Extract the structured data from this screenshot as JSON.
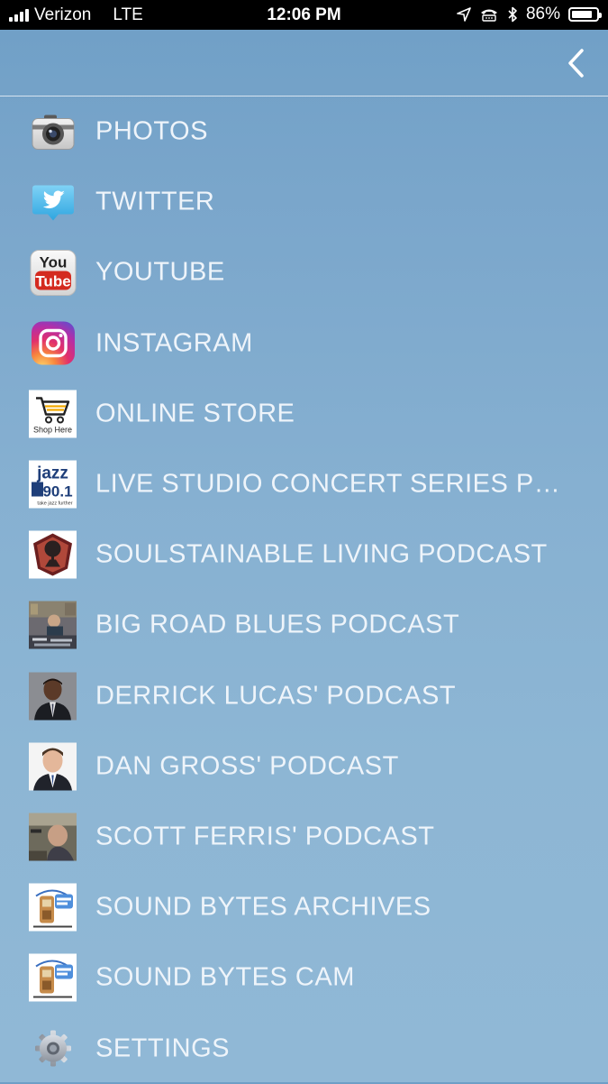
{
  "status_bar": {
    "carrier": "Verizon",
    "network": "LTE",
    "time": "12:06 PM",
    "battery_percent": "86%",
    "battery_level": 0.86
  },
  "nav": {
    "back_icon": "chevron-left-icon"
  },
  "icon_text": {
    "youtube_top": "You",
    "youtube_bottom": "Tube",
    "shop_here": "Shop Here",
    "jazz_word": "jazz",
    "jazz_freq": "90.1",
    "jazz_tagline": "take jazz further"
  },
  "menu": {
    "items": [
      {
        "label": "PHOTOS",
        "icon": "camera-icon"
      },
      {
        "label": "TWITTER",
        "icon": "twitter-icon"
      },
      {
        "label": "YOUTUBE",
        "icon": "youtube-icon"
      },
      {
        "label": "INSTAGRAM",
        "icon": "instagram-icon"
      },
      {
        "label": "ONLINE STORE",
        "icon": "shopping-cart-icon"
      },
      {
        "label": "LIVE STUDIO CONCERT SERIES P…",
        "icon": "jazz-901-logo-icon"
      },
      {
        "label": "SOULSTAINABLE LIVING PODCAST",
        "icon": "soulstainable-logo-icon"
      },
      {
        "label": "BIG ROAD BLUES PODCAST",
        "icon": "studio-photo-icon"
      },
      {
        "label": "DERRICK LUCAS' PODCAST",
        "icon": "portrait-photo-icon"
      },
      {
        "label": "DAN GROSS' PODCAST",
        "icon": "portrait-photo-icon"
      },
      {
        "label": "SCOTT FERRIS' PODCAST",
        "icon": "portrait-photo-icon"
      },
      {
        "label": "SOUND BYTES ARCHIVES",
        "icon": "sound-bytes-logo-icon"
      },
      {
        "label": "SOUND BYTES CAM",
        "icon": "sound-bytes-logo-icon"
      },
      {
        "label": "SETTINGS",
        "icon": "gear-icon"
      }
    ]
  }
}
